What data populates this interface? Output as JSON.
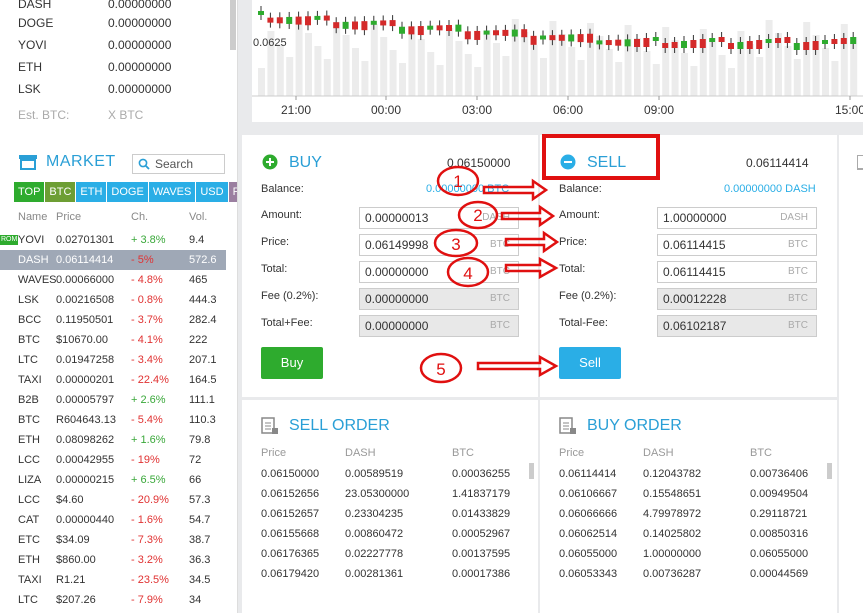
{
  "balances": [
    {
      "coin": "DASH",
      "value": "0.00000000"
    },
    {
      "coin": "DOGE",
      "value": "0.00000000"
    },
    {
      "coin": "YOVI",
      "value": "0.00000000"
    },
    {
      "coin": "ETH",
      "value": "0.00000000"
    },
    {
      "coin": "LSK",
      "value": "0.00000000"
    }
  ],
  "est": {
    "label": "Est. BTC:",
    "value": "X BTC"
  },
  "market": {
    "title": "MARKET",
    "search_placeholder": "Search",
    "tabs": [
      {
        "label": "TOP",
        "color": "#2eab2e"
      },
      {
        "label": "BTC",
        "color": "#6d9e34"
      },
      {
        "label": "ETH",
        "color": "#2aaee6"
      },
      {
        "label": "DOGE",
        "color": "#2aaee6"
      },
      {
        "label": "WAVES",
        "color": "#2aaee6"
      },
      {
        "label": "USD",
        "color": "#2aaee6"
      },
      {
        "label": "RUR",
        "color": "#9b7fa0"
      }
    ],
    "columns": [
      "Name",
      "Price",
      "Ch.",
      "Vol."
    ],
    "rows": [
      {
        "badge": "ROM",
        "name": "YOVI",
        "price": "0.02701301",
        "change": "+ 3.8%",
        "dir": "up",
        "vol": "9.4"
      },
      {
        "name": "DASH",
        "price": "0.06114414",
        "change": "- 5%",
        "dir": "dn",
        "vol": "572.6",
        "selected": true
      },
      {
        "name": "WAVES",
        "price": "0.00066000",
        "change": "- 4.8%",
        "dir": "dn",
        "vol": "465"
      },
      {
        "name": "LSK",
        "price": "0.00216508",
        "change": "- 0.8%",
        "dir": "dn",
        "vol": "444.3"
      },
      {
        "name": "BCC",
        "price": "0.11950501",
        "change": "- 3.7%",
        "dir": "dn",
        "vol": "282.4"
      },
      {
        "name": "BTC",
        "price": "$10670.00",
        "change": "- 4.1%",
        "dir": "dn",
        "vol": "222"
      },
      {
        "name": "LTC",
        "price": "0.01947258",
        "change": "- 3.4%",
        "dir": "dn",
        "vol": "207.1"
      },
      {
        "name": "TAXI",
        "price": "0.00000201",
        "change": "- 22.4%",
        "dir": "dn",
        "vol": "164.5"
      },
      {
        "name": "B2B",
        "price": "0.00005797",
        "change": "+ 2.6%",
        "dir": "up",
        "vol": "111.1"
      },
      {
        "name": "BTC",
        "price": "R604643.13",
        "change": "- 5.4%",
        "dir": "dn",
        "vol": "110.3"
      },
      {
        "name": "ETH",
        "price": "0.08098262",
        "change": "+ 1.6%",
        "dir": "up",
        "vol": "79.8"
      },
      {
        "name": "LCC",
        "price": "0.00042955",
        "change": "- 19%",
        "dir": "dn",
        "vol": "72"
      },
      {
        "name": "LIZA",
        "price": "0.00000215",
        "change": "+ 6.5%",
        "dir": "up",
        "vol": "66"
      },
      {
        "name": "LCC",
        "price": "$4.60",
        "change": "- 20.9%",
        "dir": "dn",
        "vol": "57.3"
      },
      {
        "name": "CAT",
        "price": "0.00000440",
        "change": "- 1.6%",
        "dir": "dn",
        "vol": "54.7"
      },
      {
        "name": "ETC",
        "price": "$34.09",
        "change": "- 7.3%",
        "dir": "dn",
        "vol": "38.7"
      },
      {
        "name": "ETH",
        "price": "$860.00",
        "change": "- 3.2%",
        "dir": "dn",
        "vol": "36.3"
      },
      {
        "name": "TAXI",
        "price": "R1.21",
        "change": "- 23.5%",
        "dir": "dn",
        "vol": "34.5"
      },
      {
        "name": "LTC",
        "price": "$207.26",
        "change": "- 7.9%",
        "dir": "dn",
        "vol": "34"
      }
    ]
  },
  "chart": {
    "price_label": "0.0625",
    "times": [
      "21:00",
      "00:00",
      "03:00",
      "06:00",
      "09:00",
      "15:00"
    ]
  },
  "buy": {
    "title": "BUY",
    "price": "0.06150000",
    "balance_label": "Balance:",
    "balance_value": "0.00000000 BTC",
    "amount_label": "Amount:",
    "amount_value": "0.00000013",
    "amount_unit": "DASH",
    "price_label": "Price:",
    "price_value": "0.06149998",
    "price_unit": "BTC",
    "total_label": "Total:",
    "total_value": "0.00000000",
    "total_unit": "BTC",
    "fee_label": "Fee (0.2%):",
    "fee_value": "0.00000000",
    "fee_unit": "BTC",
    "totalfee_label": "Total+Fee:",
    "totalfee_value": "0.00000000",
    "totalfee_unit": "BTC",
    "button": "Buy"
  },
  "sell": {
    "title": "SELL",
    "price": "0.06114414",
    "balance_label": "Balance:",
    "balance_value": "0.00000000 DASH",
    "amount_label": "Amount:",
    "amount_value": "1.00000000",
    "amount_unit": "DASH",
    "price_label": "Price:",
    "price_value": "0.06114415",
    "price_unit": "BTC",
    "total_label": "Total:",
    "total_value": "0.06114415",
    "total_unit": "BTC",
    "fee_label": "Fee (0.2%):",
    "fee_value": "0.00012228",
    "fee_unit": "BTC",
    "totalfee_label": "Total-Fee:",
    "totalfee_value": "0.06102187",
    "totalfee_unit": "BTC",
    "button": "Sell"
  },
  "sell_order": {
    "title": "SELL ORDER",
    "columns": [
      "Price",
      "DASH",
      "BTC"
    ],
    "rows": [
      [
        "0.06150000",
        "0.00589519",
        "0.00036255"
      ],
      [
        "0.06152656",
        "23.05300000",
        "1.41837179"
      ],
      [
        "0.06152657",
        "0.23304235",
        "0.01433829"
      ],
      [
        "0.06155668",
        "0.00860472",
        "0.00052967"
      ],
      [
        "0.06176365",
        "0.02227778",
        "0.00137595"
      ],
      [
        "0.06179420",
        "0.00281361",
        "0.00017386"
      ]
    ]
  },
  "buy_order": {
    "title": "BUY ORDER",
    "columns": [
      "Price",
      "DASH",
      "BTC"
    ],
    "rows": [
      [
        "0.06114414",
        "0.12043782",
        "0.00736406"
      ],
      [
        "0.06106667",
        "0.15548651",
        "0.00949504"
      ],
      [
        "0.06066666",
        "4.79978972",
        "0.29118721"
      ],
      [
        "0.06062514",
        "0.14025802",
        "0.00850316"
      ],
      [
        "0.06055000",
        "1.00000000",
        "0.06055000"
      ],
      [
        "0.06053343",
        "0.00736287",
        "0.00044569"
      ]
    ]
  },
  "annotations": [
    "1",
    "2",
    "3",
    "4",
    "5"
  ],
  "colors": {
    "accent": "#2aaee6",
    "buy": "#2eab2e",
    "sell": "#2aaee6",
    "annotation": "#e01010",
    "up": "#3aa83a",
    "down": "#e03232"
  }
}
